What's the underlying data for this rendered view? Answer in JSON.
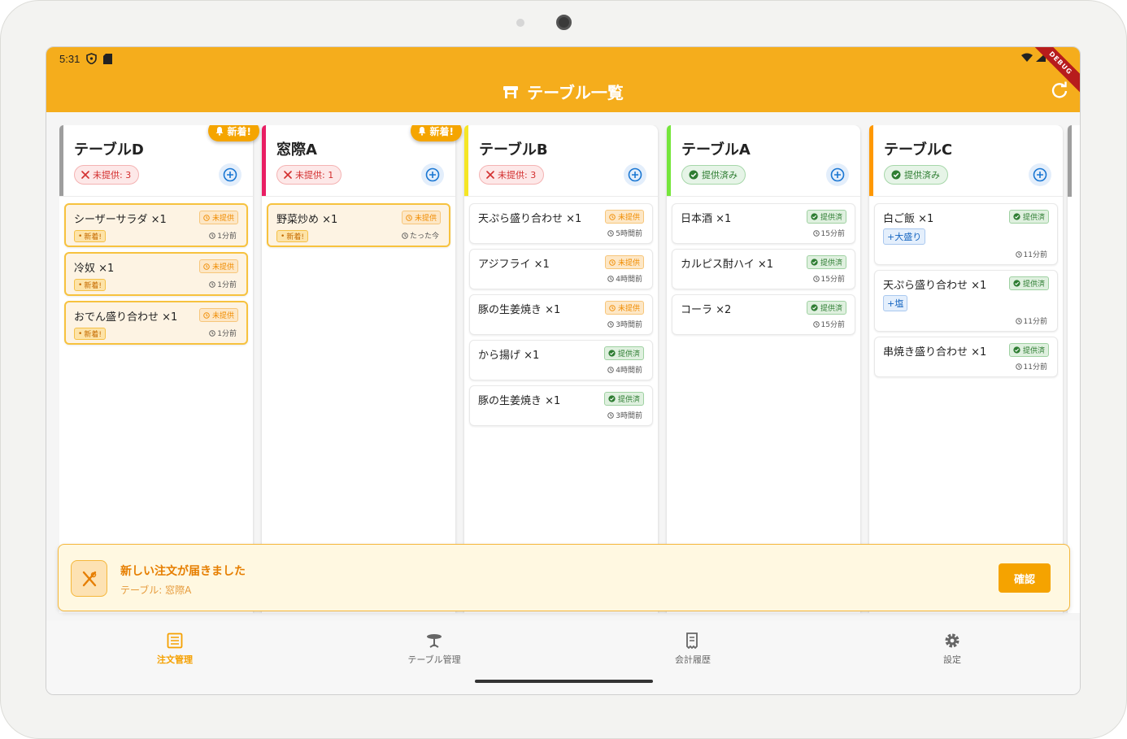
{
  "status_bar": {
    "time": "5:31"
  },
  "app_bar": {
    "title": "テーブル一覧",
    "debug_label": "DEBUG"
  },
  "columns": [
    {
      "name": "テーブルD",
      "accent": "#9e9e9e",
      "status": "未提供: 3",
      "status_type": "red",
      "new_badge": "新着!",
      "items": [
        {
          "name": "シーザーサラダ ×1",
          "status": "未提供",
          "type": "pending",
          "new_tag": "新着!",
          "time": "1分前",
          "highlight": true
        },
        {
          "name": "冷奴 ×1",
          "status": "未提供",
          "type": "pending",
          "new_tag": "新着!",
          "time": "1分前",
          "highlight": true
        },
        {
          "name": "おでん盛り合わせ ×1",
          "status": "未提供",
          "type": "pending",
          "new_tag": "新着!",
          "time": "1分前",
          "highlight": true
        }
      ]
    },
    {
      "name": "窓際A",
      "accent": "#e91e63",
      "status": "未提供: 1",
      "status_type": "red",
      "new_badge": "新着!",
      "items": [
        {
          "name": "野菜炒め ×1",
          "status": "未提供",
          "type": "pending",
          "new_tag": "新着!",
          "time": "たった今",
          "highlight": true
        }
      ]
    },
    {
      "name": "テーブルB",
      "accent": "#f5e626",
      "status": "未提供: 3",
      "status_type": "red",
      "new_badge": "",
      "items": [
        {
          "name": "天ぷら盛り合わせ ×1",
          "status": "未提供",
          "type": "pending",
          "time": "5時間前"
        },
        {
          "name": "アジフライ ×1",
          "status": "未提供",
          "type": "pending",
          "time": "4時間前"
        },
        {
          "name": "豚の生姜焼き ×1",
          "status": "未提供",
          "type": "pending",
          "time": "3時間前"
        },
        {
          "name": "から揚げ ×1",
          "status": "提供済",
          "type": "served",
          "time": "4時間前"
        },
        {
          "name": "豚の生姜焼き ×1",
          "status": "提供済",
          "type": "served",
          "time": "3時間前"
        }
      ]
    },
    {
      "name": "テーブルA",
      "accent": "#76e63c",
      "status": "提供済み",
      "status_type": "green",
      "new_badge": "",
      "items": [
        {
          "name": "日本酒 ×1",
          "status": "提供済",
          "type": "served",
          "time": "15分前"
        },
        {
          "name": "カルピス酎ハイ ×1",
          "status": "提供済",
          "type": "served",
          "time": "15分前"
        },
        {
          "name": "コーラ ×2",
          "status": "提供済",
          "type": "served",
          "time": "15分前"
        }
      ]
    },
    {
      "name": "テーブルC",
      "accent": "#ff9800",
      "status": "提供済み",
      "status_type": "green",
      "new_badge": "",
      "items": [
        {
          "name": "白ご飯 ×1",
          "status": "提供済",
          "type": "served",
          "option": "+大盛り",
          "time": "11分前"
        },
        {
          "name": "天ぷら盛り合わせ ×1",
          "status": "提供済",
          "type": "served",
          "option": "+塩",
          "time": "11分前"
        },
        {
          "name": "串焼き盛り合わせ ×1",
          "status": "提供済",
          "type": "served",
          "time": "11分前"
        }
      ]
    }
  ],
  "notification": {
    "title": "新しい注文が届きました",
    "subtitle": "テーブル: 窓際A",
    "button": "確認"
  },
  "nav": [
    {
      "label": "注文管理",
      "icon": "list-icon",
      "active": true
    },
    {
      "label": "テーブル管理",
      "icon": "table-icon",
      "active": false
    },
    {
      "label": "会計履歴",
      "icon": "receipt-icon",
      "active": false
    },
    {
      "label": "設定",
      "icon": "gear-icon",
      "active": false
    }
  ]
}
